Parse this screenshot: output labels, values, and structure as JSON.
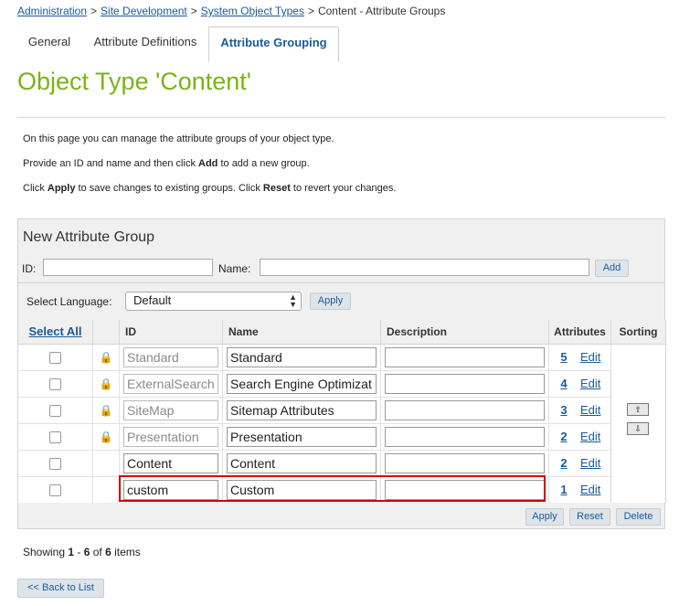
{
  "breadcrumb": {
    "items": [
      "Administration",
      "Site Development",
      "System Object Types"
    ],
    "current": "Content - Attribute Groups",
    "separator": ">"
  },
  "tabs": [
    "General",
    "Attribute Definitions",
    "Attribute Grouping"
  ],
  "page_title": "Object Type 'Content'",
  "intro": {
    "line1": "On this page you can manage the attribute groups of your object type.",
    "line2_pre": "Provide an ID and name and then click ",
    "line2_bold": "Add",
    "line2_post": " to add a new group.",
    "line3_pre": "Click ",
    "line3_bold1": "Apply",
    "line3_mid": " to save changes to existing groups. Click ",
    "line3_bold2": "Reset",
    "line3_post": " to revert your changes."
  },
  "new_group": {
    "title": "New Attribute Group",
    "id_label": "ID:",
    "name_label": "Name:",
    "id_value": "",
    "name_value": "",
    "add_label": "Add"
  },
  "language": {
    "label": "Select Language:",
    "selected": "Default",
    "apply_label": "Apply"
  },
  "table": {
    "select_all": "Select All",
    "headers": [
      "ID",
      "Name",
      "Description",
      "Attributes",
      "Sorting"
    ],
    "rows": [
      {
        "id": "Standard",
        "name": "Standard",
        "description": "",
        "attributes": "5",
        "edit": "Edit",
        "locked": true
      },
      {
        "id": "ExternalSearch",
        "name": "Search Engine Optimizat",
        "description": "",
        "attributes": "4",
        "edit": "Edit",
        "locked": true
      },
      {
        "id": "SiteMap",
        "name": "Sitemap Attributes",
        "description": "",
        "attributes": "3",
        "edit": "Edit",
        "locked": true
      },
      {
        "id": "Presentation",
        "name": "Presentation",
        "description": "",
        "attributes": "2",
        "edit": "Edit",
        "locked": true
      },
      {
        "id": "Content",
        "name": "Content",
        "description": "",
        "attributes": "2",
        "edit": "Edit",
        "locked": false
      },
      {
        "id": "custom",
        "name": "Custom",
        "description": "",
        "attributes": "1",
        "edit": "Edit",
        "locked": false
      }
    ],
    "sort_up_icon": "arrow-up-icon",
    "sort_down_icon": "arrow-down-icon"
  },
  "footer_buttons": {
    "apply": "Apply",
    "reset": "Reset",
    "delete": "Delete"
  },
  "paging": {
    "prefix": "Showing ",
    "from": "1",
    "dash": " - ",
    "to": "6",
    "of": " of ",
    "total": "6",
    "suffix": " items"
  },
  "back_label": "<< Back to List",
  "colors": {
    "title_green": "#7ab317",
    "link_blue": "#1a5a9c",
    "highlight_red": "#d00000"
  }
}
